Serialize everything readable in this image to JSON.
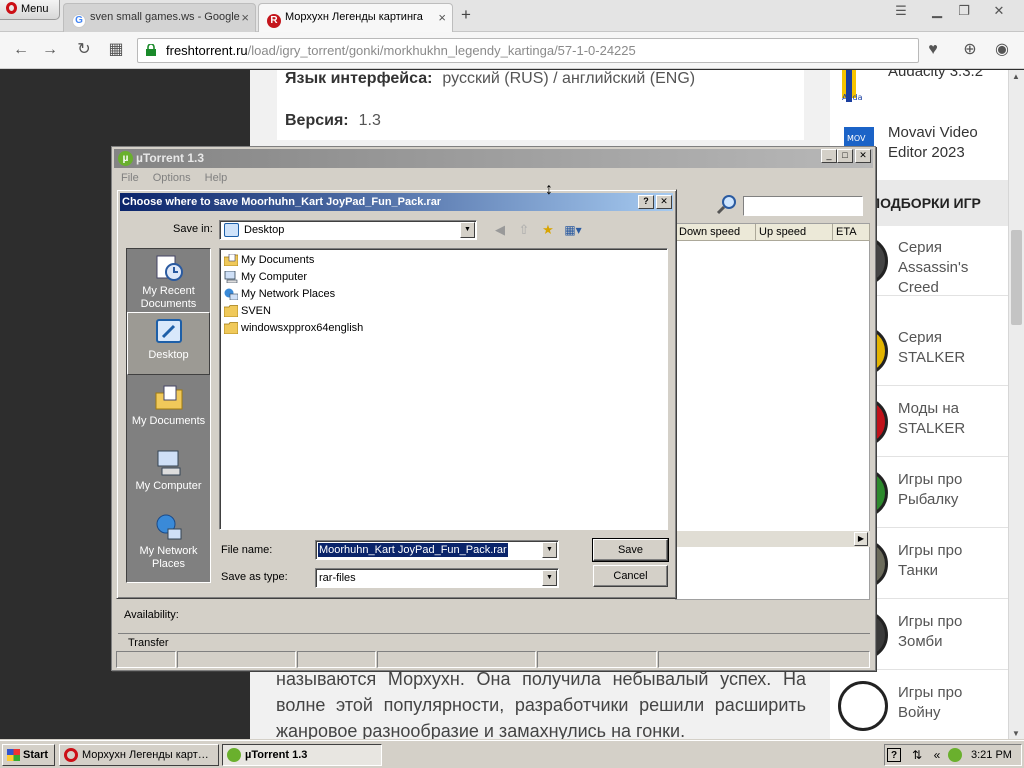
{
  "browser": {
    "menu_label": "Menu",
    "tabs": [
      {
        "title": "sven small games.ws - Google",
        "favicon": "google-icon"
      },
      {
        "title": "Морхухн Легенды картинга",
        "favicon": "freshtorrent-icon"
      }
    ],
    "url_host": "freshtorrent.ru",
    "url_path": "/load/igry_torrent/gonki/morkhukhn_legendy_kartinga/57-1-0-24225"
  },
  "page": {
    "lang_label": "Язык интерфейса:",
    "lang_value": "русский (RUS) / английский (ENG)",
    "version_label": "Версия:",
    "version_value": "1.3",
    "article_text": "называются Морхухн. Она получила небывалый успех. На волне этой популярности, разработчики решили расширить жанровое разнообразие и замахнулись на гонки.",
    "sidebar": {
      "apps": [
        {
          "name": "Audacity 3.3.2",
          "icon": "audacity-icon"
        },
        {
          "name": "Movavi Video Editor 2023",
          "icon": "movavi-icon"
        }
      ],
      "categories_heading": "ПОДБОРКИ ИГР",
      "categories": [
        {
          "label": "Серия Assassin's Creed"
        },
        {
          "label": "Серия STALKER"
        },
        {
          "label": "Моды на STALKER"
        },
        {
          "label": "Игры про Рыбалку"
        },
        {
          "label": "Игры про Танки"
        },
        {
          "label": "Игры про Зомби"
        },
        {
          "label": "Игры про Войну"
        }
      ]
    }
  },
  "utorrent": {
    "title": "µTorrent 1.3",
    "menu": [
      "File",
      "Options",
      "Help"
    ],
    "columns": [
      "Down speed",
      "Up speed",
      "ETA"
    ],
    "availability_label": "Availability:",
    "transfer_label": "Transfer"
  },
  "dialog": {
    "title": "Choose where to save Moorhuhn_Kart JoyPad_Fun_Pack.rar",
    "save_in_label": "Save in:",
    "save_in_value": "Desktop",
    "places": [
      {
        "label": "My Recent Documents",
        "icon": "recent-documents-icon"
      },
      {
        "label": "Desktop",
        "icon": "desktop-icon"
      },
      {
        "label": "My Documents",
        "icon": "my-documents-icon"
      },
      {
        "label": "My Computer",
        "icon": "my-computer-icon"
      },
      {
        "label": "My Network Places",
        "icon": "network-places-icon"
      }
    ],
    "files": [
      {
        "name": "My Documents",
        "icon": "my-documents-icon"
      },
      {
        "name": "My Computer",
        "icon": "my-computer-icon"
      },
      {
        "name": "My Network Places",
        "icon": "network-places-icon"
      },
      {
        "name": "SVEN",
        "icon": "folder-icon"
      },
      {
        "name": "windowsxpprox64english",
        "icon": "folder-icon"
      }
    ],
    "file_name_label": "File name:",
    "file_name_value": "Moorhuhn_Kart JoyPad_Fun_Pack.rar",
    "save_as_type_label": "Save as type:",
    "save_as_type_value": "rar-files",
    "save_button": "Save",
    "cancel_button": "Cancel",
    "help_button": "?",
    "close_button": "✕"
  },
  "taskbar": {
    "start_label": "Start",
    "tasks": [
      {
        "label": "Морхухн Легенды карт…"
      },
      {
        "label": "µTorrent 1.3"
      }
    ],
    "clock": "3:21 PM"
  },
  "colors": {
    "dialog_title_start": "#0a246a",
    "dialog_title_end": "#a6caf0",
    "utorrent_green": "#6ab02d",
    "opera_red": "#cc0f16",
    "selection": "#0a246a"
  }
}
